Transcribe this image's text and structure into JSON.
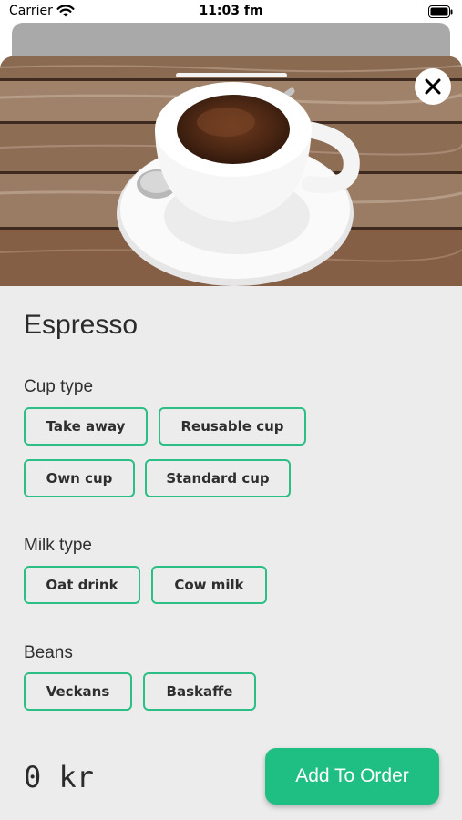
{
  "status_bar": {
    "carrier": "Carrier",
    "time": "11:03 fm",
    "wifi_icon": "wifi-icon",
    "battery_icon": "battery-icon"
  },
  "colors": {
    "accent": "#1fbf83",
    "chip_border": "#2bbf86",
    "sheet_background": "#ececec"
  },
  "product": {
    "title": "Espresso",
    "image": "espresso-cup-photo"
  },
  "close_icon": "close-icon",
  "sections": {
    "cup_type": {
      "label": "Cup type",
      "options": [
        "Take away",
        "Reusable cup",
        "Own cup",
        "Standard cup"
      ]
    },
    "milk_type": {
      "label": "Milk type",
      "options": [
        "Oat drink",
        "Cow milk"
      ]
    },
    "beans": {
      "label": "Beans",
      "options": [
        "Veckans",
        "Baskaffe"
      ]
    }
  },
  "footer": {
    "price": "0 kr",
    "add_button": "Add To Order"
  }
}
